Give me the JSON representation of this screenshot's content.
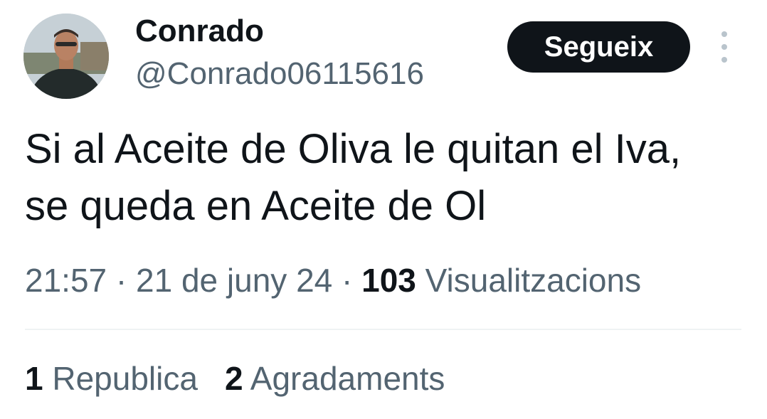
{
  "author": {
    "name": "Conrado",
    "handle": "@Conrado06115616"
  },
  "follow_button": {
    "label": "Segueix"
  },
  "more_menu": {
    "icon": "more-vertical-icon"
  },
  "tweet": {
    "line1": "Si al Aceite de Oliva le quitan el Iva,",
    "line2": "se queda en Aceite de Ol"
  },
  "meta": {
    "time": "21:57",
    "sep1": " · ",
    "date": "21 de juny 24",
    "sep2": " · ",
    "views_count": "103",
    "views_label": " Visualitzacions"
  },
  "stats": {
    "reposts_count": "1",
    "reposts_label": " Republica",
    "likes_count": "2",
    "likes_label": " Agradaments"
  },
  "colors": {
    "text": "#0f1419",
    "secondary": "#536471",
    "button_bg": "#0f1419",
    "button_text": "#ffffff",
    "divider": "#eff3f4"
  }
}
